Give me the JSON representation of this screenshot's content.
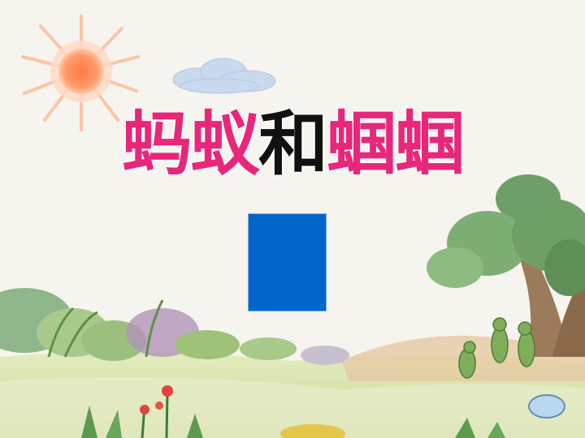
{
  "title": {
    "part1": "蚂蚁",
    "part2": "和",
    "part3": "蝈蝈"
  },
  "colors": {
    "title_pink": "#e8277b",
    "title_black": "#111111",
    "rect_blue": "#0066cc",
    "oval_fill": "#b9d7ee",
    "sky": "#f6f4ee",
    "ground": "#d9e3a8"
  },
  "icons": [
    "sun-icon",
    "cloud-icon",
    "tree-icon",
    "grasshopper-icon",
    "flower-icon"
  ]
}
